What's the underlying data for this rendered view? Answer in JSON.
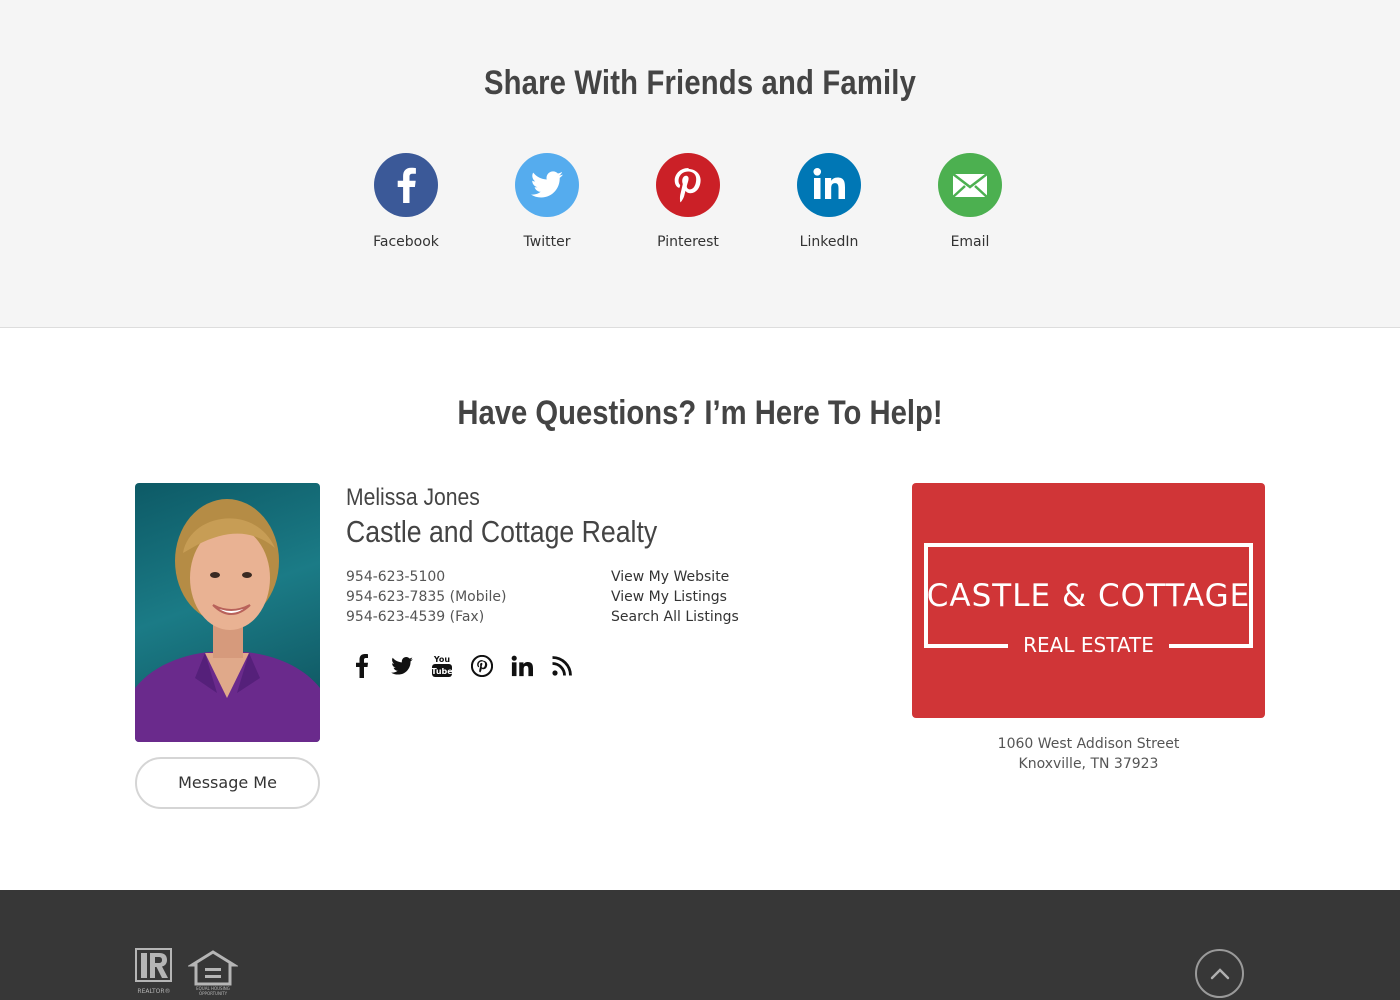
{
  "share": {
    "title": "Share With Friends and Family",
    "items": [
      {
        "label": "Facebook",
        "icon": "facebook-icon",
        "color": "#3b5998"
      },
      {
        "label": "Twitter",
        "icon": "twitter-icon",
        "color": "#55acee"
      },
      {
        "label": "Pinterest",
        "icon": "pinterest-icon",
        "color": "#cb2027"
      },
      {
        "label": "LinkedIn",
        "icon": "linkedin-icon",
        "color": "#0077b5"
      },
      {
        "label": "Email",
        "icon": "email-icon",
        "color": "#4cb050"
      }
    ]
  },
  "contact": {
    "title": "Have Questions? I’m Here To Help!",
    "agent_name": "Melissa Jones",
    "company": "Castle and Cottage Realty",
    "phones": [
      "954-623-5100",
      "954-623-7835 (Mobile)",
      "954-623-4539 (Fax)"
    ],
    "links": [
      "View My Website",
      "View My Listings",
      "Search All Listings"
    ],
    "social_icons": [
      "facebook-icon",
      "twitter-icon",
      "youtube-icon",
      "pinterest-icon",
      "linkedin-icon",
      "rss-icon"
    ],
    "message_button": "Message Me"
  },
  "brokerage": {
    "logo_line1": "CASTLE & COTTAGE",
    "logo_line2": "REAL ESTATE",
    "logo_color": "#d03537",
    "address_line1": "1060 West Addison Street",
    "address_line2": "Knoxville, TN 37923"
  },
  "footer": {
    "background": "#373737",
    "realtor_label": "REALTOR®",
    "eho_label": "EQUAL HOUSING OPPORTUNITY",
    "scroll_top_icon": "chevron-up-icon"
  }
}
